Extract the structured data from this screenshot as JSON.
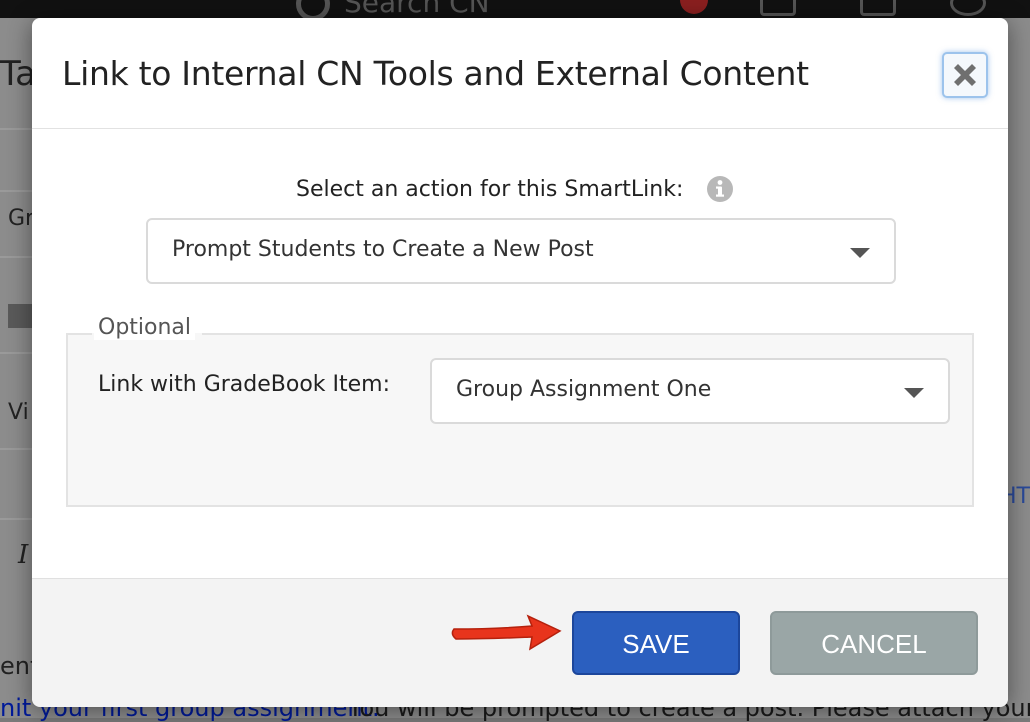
{
  "background": {
    "search_placeholder": "Search CN",
    "side_fragments": [
      "Tas",
      "Gr",
      "Vi",
      "I"
    ],
    "bottom_left_fragment": "ent",
    "bottom_link": "nit your first group assignment.",
    "bottom_text": " You will be prompted to create a post. Please attach your gr",
    "right_fragment": "HT"
  },
  "modal": {
    "title": "Link to Internal CN Tools and External Content",
    "close_icon": "close-icon",
    "action_label": "Select an action for this SmartLink:",
    "info_icon": "info-icon",
    "action_select": {
      "selected": "Prompt Students to Create a New Post"
    },
    "optional": {
      "legend": "Optional",
      "gradebook_label": "Link with GradeBook Item:",
      "gradebook_select": {
        "selected": "Group Assignment One"
      }
    },
    "footer": {
      "save_label": "SAVE",
      "cancel_label": "CANCEL"
    }
  },
  "colors": {
    "save": "#2b5fbf",
    "cancel": "#9aa6a6",
    "arrow": "#e8341c"
  }
}
